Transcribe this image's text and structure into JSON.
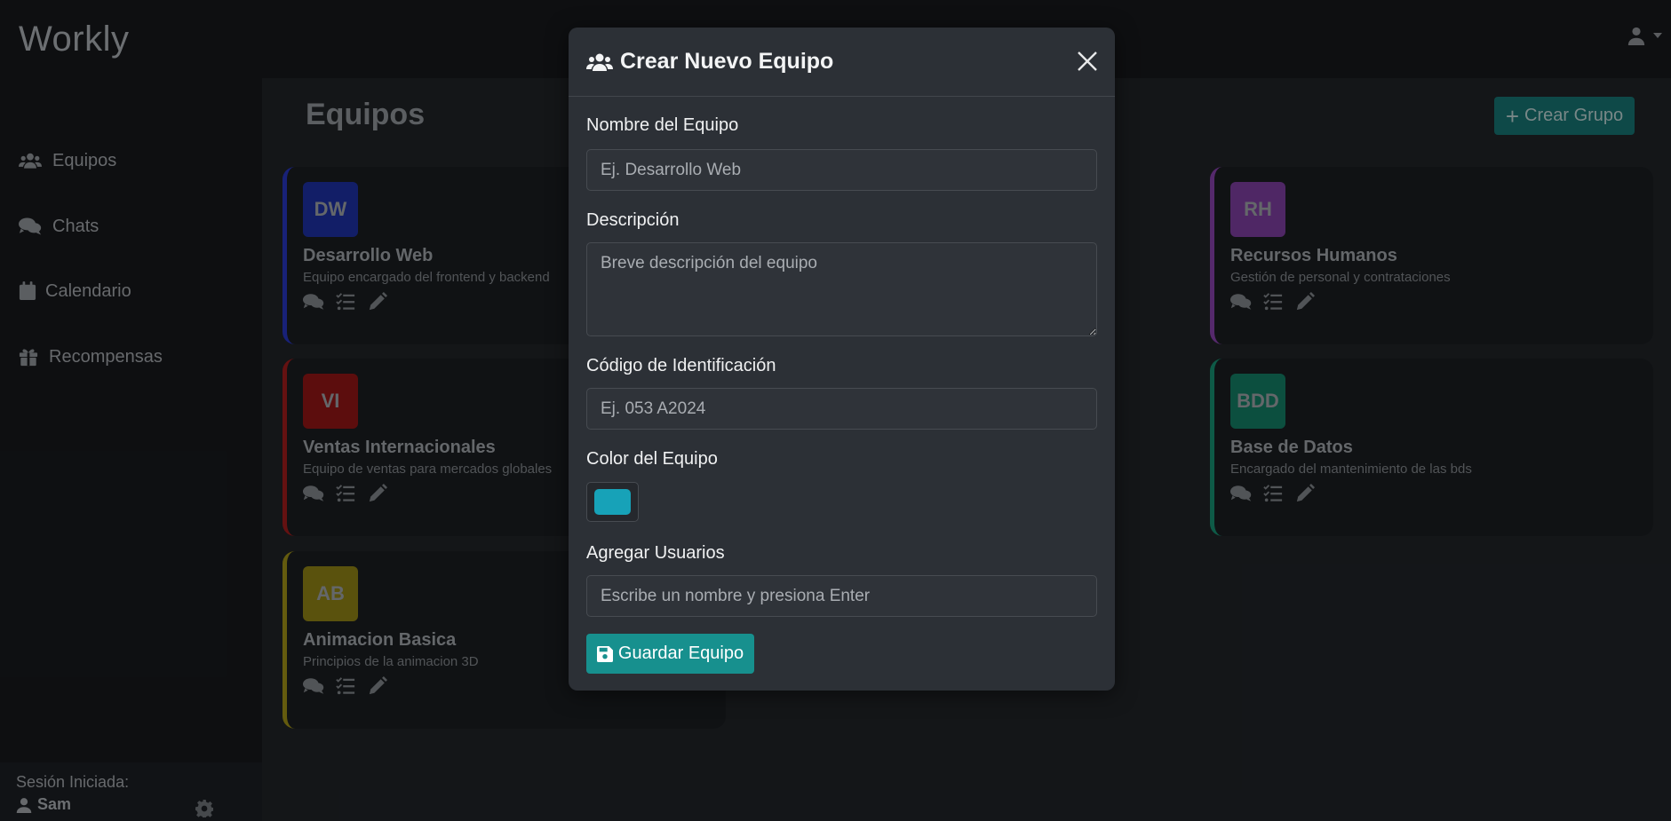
{
  "app": {
    "brand": "Workly"
  },
  "sidebar": {
    "items": [
      {
        "label": "Equipos",
        "icon": "users-icon"
      },
      {
        "label": "Chats",
        "icon": "comments-icon"
      },
      {
        "label": "Calendario",
        "icon": "calendar-icon"
      },
      {
        "label": "Recompensas",
        "icon": "gift-icon"
      }
    ],
    "session_label": "Sesión Iniciada:",
    "user_name": "Sam"
  },
  "main": {
    "title": "Equipos",
    "create_button": "Crear Grupo"
  },
  "teams": [
    {
      "initials": "DW",
      "name": "Desarrollo Web",
      "description": "Equipo encargado del frontend y backend",
      "color": "#1d2f9e",
      "border": "#2634b8"
    },
    {
      "initials": "RH",
      "name": "Recursos Humanos",
      "description": "Gestión de personal y contrataciones",
      "color": "#7a3c9c",
      "border": "#8340a6"
    },
    {
      "initials": "VI",
      "name": "Ventas Internacionales",
      "description": "Equipo de ventas para mercados globales",
      "color": "#8e1515",
      "border": "#9a1b1b"
    },
    {
      "initials": "BDD",
      "name": "Base de Datos",
      "description": "Encargado del mantenimiento de las bds",
      "color": "#137a62",
      "border": "#168a6d"
    },
    {
      "initials": "AB",
      "name": "Animacion Basica",
      "description": "Principios de la animacion 3D",
      "color": "#8a7f14",
      "border": "#9a8d16"
    }
  ],
  "modal": {
    "title": "Crear Nuevo Equipo",
    "name_label": "Nombre del Equipo",
    "name_placeholder": "Ej. Desarrollo Web",
    "description_label": "Descripción",
    "description_placeholder": "Breve descripción del equipo",
    "code_label": "Código de Identificación",
    "code_placeholder": "Ej. 053 A2024",
    "color_label": "Color del Equipo",
    "color_value": "#17a2b8",
    "users_label": "Agregar Usuarios",
    "users_placeholder": "Escribe un nombre y presiona Enter",
    "save_button": "Guardar Equipo"
  }
}
